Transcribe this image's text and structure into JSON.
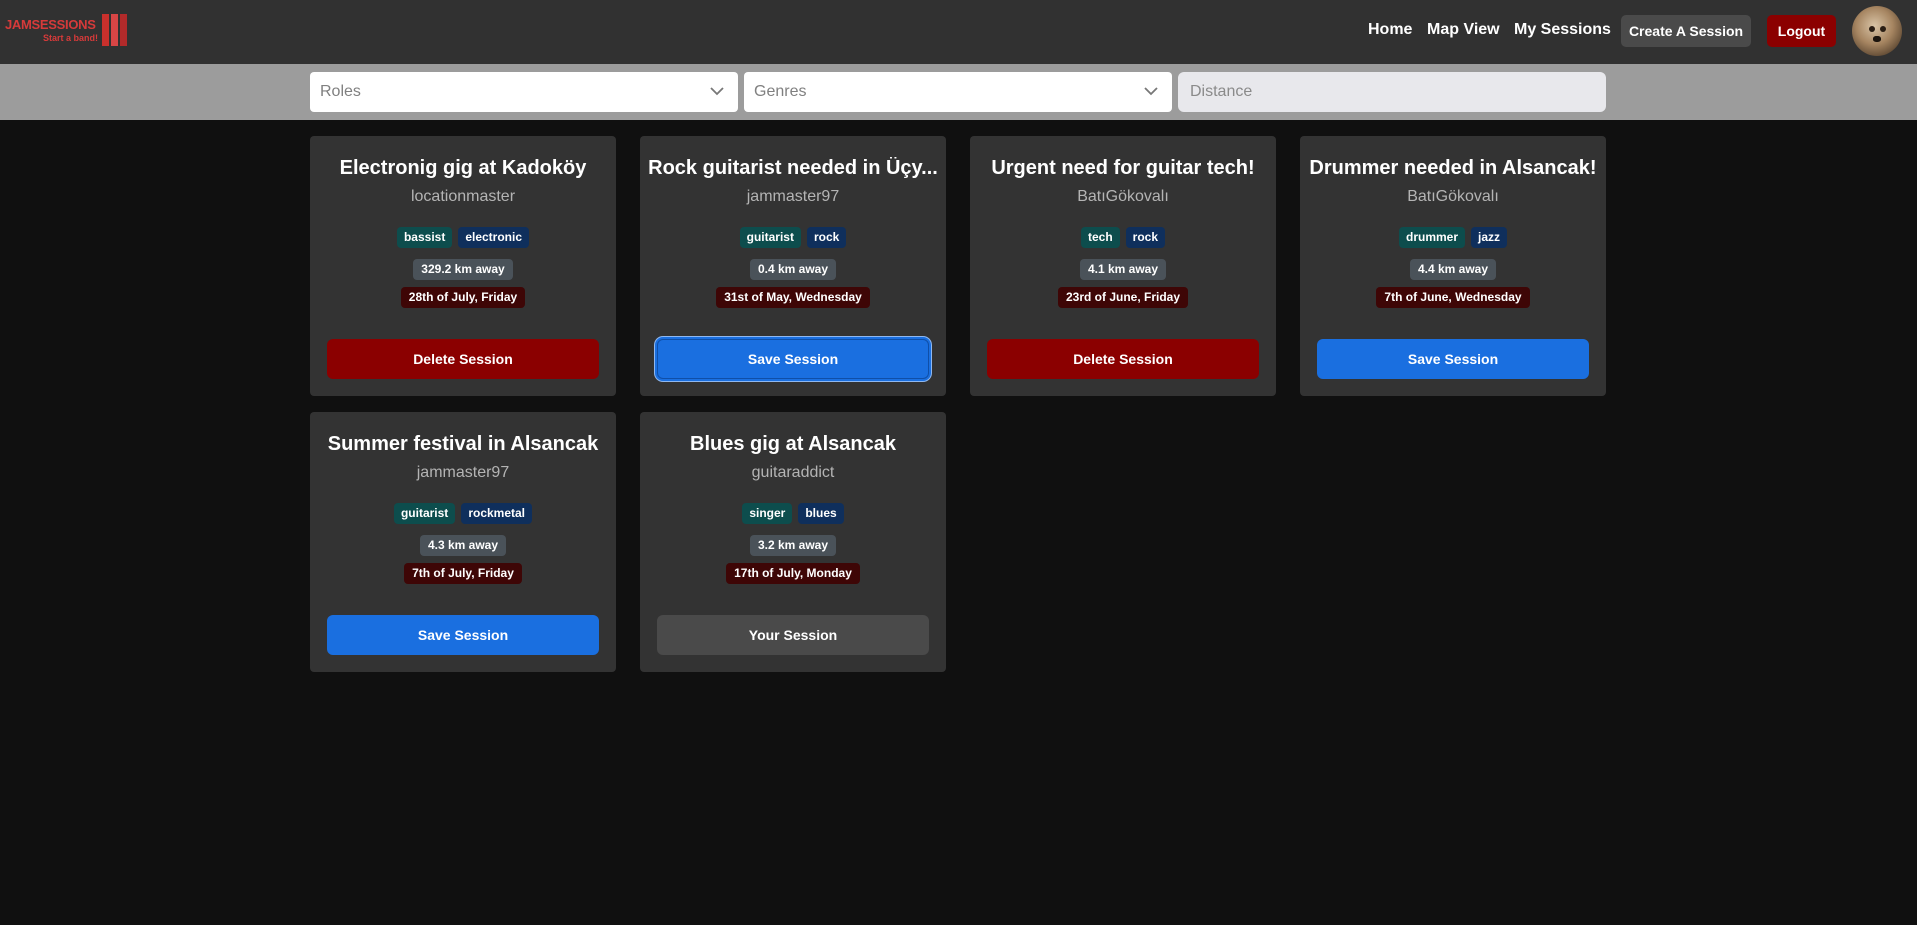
{
  "brand": {
    "name": "JAMSESSIONS",
    "tagline": "Start a band!"
  },
  "nav": {
    "home": "Home",
    "map_view": "Map View",
    "my_sessions": "My Sessions",
    "create_session": "Create A Session",
    "logout": "Logout"
  },
  "filters": {
    "roles_placeholder": "Roles",
    "genres_placeholder": "Genres",
    "distance_placeholder": "Distance"
  },
  "colors": {
    "delete": "#8b0000",
    "save": "#1a6fe0",
    "own": "#4a4a4a",
    "role_tag": "#0d4d4d",
    "genre_tag": "#0f2f5c",
    "date_tag": "#3e0606"
  },
  "sessions": [
    {
      "title": "Electronig gig at Kadoköy",
      "user": "locationmaster",
      "role": "bassist",
      "genre": "electronic",
      "distance": "329.2 km away",
      "date": "28th of July, Friday",
      "action": "Delete Session"
    },
    {
      "title": "Rock guitarist needed in Üçy...",
      "user": "jammaster97",
      "role": "guitarist",
      "genre": "rock",
      "distance": "0.4 km away",
      "date": "31st of May, Wednesday",
      "action": "Save Session"
    },
    {
      "title": "Urgent need for guitar tech!",
      "user": "BatıGökovalı",
      "role": "tech",
      "genre": "rock",
      "distance": "4.1 km away",
      "date": "23rd of June, Friday",
      "action": "Delete Session"
    },
    {
      "title": "Drummer needed in Alsancak!",
      "user": "BatıGökovalı",
      "role": "drummer",
      "genre": "jazz",
      "distance": "4.4 km away",
      "date": "7th of June, Wednesday",
      "action": "Save Session"
    },
    {
      "title": "Summer festival in Alsancak",
      "user": "jammaster97",
      "role": "guitarist",
      "genre": "rockmetal",
      "distance": "4.3 km away",
      "date": "7th of July, Friday",
      "action": "Save Session"
    },
    {
      "title": "Blues gig at Alsancak",
      "user": "guitaraddict",
      "role": "singer",
      "genre": "blues",
      "distance": "3.2 km away",
      "date": "17th of July, Monday",
      "action": "Your Session"
    }
  ]
}
